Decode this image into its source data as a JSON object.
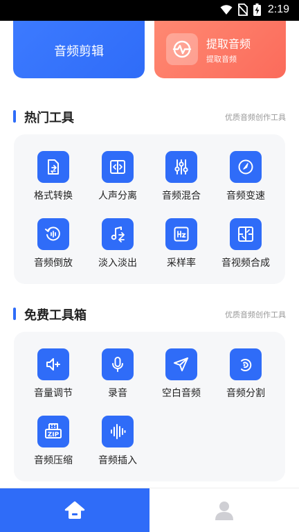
{
  "status_bar": {
    "time": "2:19"
  },
  "top_cards": {
    "edit": {
      "label": "音频剪辑"
    },
    "extract": {
      "title": "提取音频",
      "subtitle": "提取音频"
    }
  },
  "hot_tools": {
    "title": "热门工具",
    "subtitle": "优质音频创作工具",
    "items": [
      {
        "label": "格式转换",
        "icon": "format-convert-icon"
      },
      {
        "label": "人声分离",
        "icon": "vocal-separate-icon"
      },
      {
        "label": "音频混合",
        "icon": "mixer-sliders-icon"
      },
      {
        "label": "音频变速",
        "icon": "speed-gauge-icon"
      },
      {
        "label": "音频倒放",
        "icon": "reverse-play-icon"
      },
      {
        "label": "淡入淡出",
        "icon": "fade-note-icon"
      },
      {
        "label": "采样率",
        "icon": "hz-icon"
      },
      {
        "label": "音视频合成",
        "icon": "merge-icon"
      }
    ]
  },
  "free_tools": {
    "title": "免费工具箱",
    "subtitle": "优质音频创作工具",
    "items": [
      {
        "label": "音量调节",
        "icon": "volume-plus-icon"
      },
      {
        "label": "录音",
        "icon": "microphone-icon"
      },
      {
        "label": "空白音频",
        "icon": "paper-plane-icon"
      },
      {
        "label": "音频分割",
        "icon": "audio-split-icon"
      },
      {
        "label": "音频压缩",
        "icon": "zip-icon"
      },
      {
        "label": "音频插入",
        "icon": "waveform-icon"
      }
    ]
  },
  "bottom_nav": {
    "home_icon": "home-icon",
    "profile_icon": "user-icon"
  },
  "colors": {
    "primary": "#2f6cf8",
    "accent_orange": "#fb6b5b",
    "panel_bg": "#f6f7f9"
  }
}
